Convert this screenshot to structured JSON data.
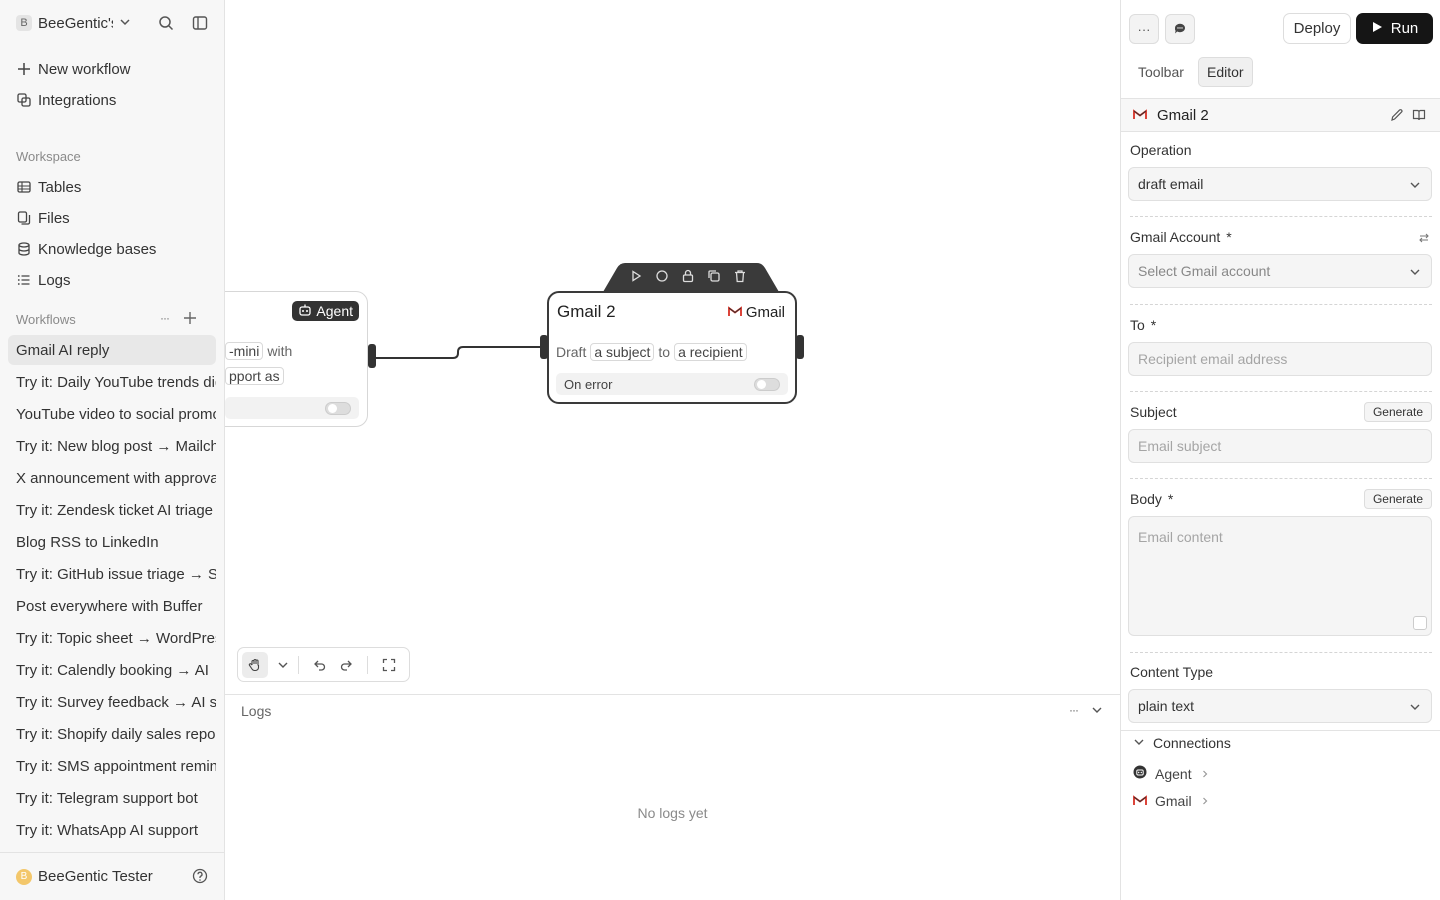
{
  "sidebar": {
    "workspace_badge": "B",
    "workspace_name": "BeeGentic's",
    "new_workflow": "New workflow",
    "integrations": "Integrations",
    "workspace_label": "Workspace",
    "workspace_items": [
      "Tables",
      "Files",
      "Knowledge bases",
      "Logs"
    ],
    "workflows_label": "Workflows",
    "workflows_more": "···",
    "workflows": [
      "Gmail AI reply",
      "Try it: Daily YouTube trends digest",
      "YouTube video to social promo",
      "Try it: New blog post → Mailchimp",
      "X announcement with approval",
      "Try it: Zendesk ticket AI triage",
      "Blog RSS to LinkedIn",
      "Try it: GitHub issue triage → Slack",
      "Post everywhere with Buffer",
      "Try it: Topic sheet → WordPress",
      "Try it: Calendly booking → AI",
      "Try it: Survey feedback → AI summary",
      "Try it: Shopify daily sales report",
      "Try it: SMS appointment reminders",
      "Try it: Telegram support bot",
      "Try it: WhatsApp AI support"
    ],
    "user_initial": "B",
    "user_name": "BeeGentic Tester"
  },
  "canvas": {
    "agent_node": {
      "tag": "Agent",
      "line1_chip": "-mini",
      "line1_text": "with",
      "line2_chip": "pport as"
    },
    "gmail_node": {
      "title": "Gmail 2",
      "tag": "Gmail",
      "draft": "Draft",
      "subject_chip": "a subject",
      "to": "to",
      "recipient_chip": "a recipient",
      "on_error": "On error"
    }
  },
  "logs": {
    "title": "Logs",
    "more": "···",
    "empty": "No logs yet"
  },
  "panel": {
    "more_button": "···",
    "deploy": "Deploy",
    "run": "Run",
    "tabs": [
      "Toolbar",
      "Editor"
    ],
    "block_name": "Gmail 2",
    "operation_label": "Operation",
    "operation_value": "draft email",
    "account_label": "Gmail Account",
    "account_placeholder": "Select Gmail account",
    "to_label": "To",
    "to_placeholder": "Recipient email address",
    "subject_label": "Subject",
    "subject_placeholder": "Email subject",
    "body_label": "Body",
    "body_placeholder": "Email content",
    "generate": "Generate",
    "required": "*",
    "content_type_label": "Content Type",
    "content_type_value": "plain text",
    "connections_label": "Connections",
    "connections": [
      "Agent",
      "Gmail"
    ]
  },
  "colors": {
    "accent_dark": "#151515",
    "gmail_red": "#d93025",
    "user_dot": "#f3c76b"
  }
}
